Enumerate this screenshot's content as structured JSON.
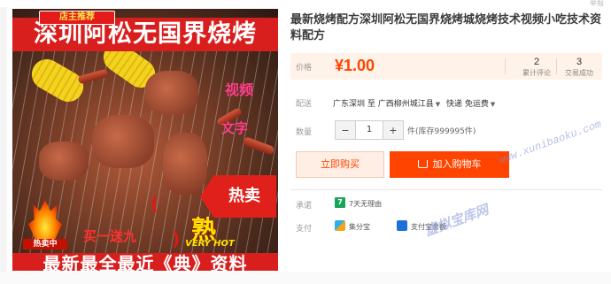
{
  "top_mark": "举报",
  "image": {
    "title": "深圳阿松无国界烧烤",
    "shop_badge": "店主推荐",
    "bottom_text": "最新最全最近《典》资料",
    "hot_arrow": "热卖",
    "hot_sticker_cn": "熟",
    "hot_sticker_en": "VERY HOT",
    "fire_badge": "热卖中",
    "pink_1": "视频",
    "pink_2": "文字",
    "red_1": "买一送九",
    "red_2": "(",
    "red_3": ")"
  },
  "product": {
    "title": "最新烧烤配方深圳阿松无国界烧烤城烧烤技术视频小吃技术资料配方"
  },
  "price": {
    "label": "价格",
    "value": "¥1.00",
    "reviews_count": "2",
    "reviews_label": "累计评论",
    "sales_count": "3",
    "sales_label": "交易成功"
  },
  "shipping": {
    "label": "配送",
    "from": "广东深圳 至",
    "to": "广西柳州城江县",
    "method": "快递 免运费"
  },
  "quantity": {
    "label": "数量",
    "minus": "−",
    "value": "1",
    "plus": "+",
    "stock": "件(库存999995件)"
  },
  "actions": {
    "buy_now": "立即购买",
    "add_to_cart": "加入购物车"
  },
  "promise": {
    "label": "承诺",
    "text": "7天无理由"
  },
  "payment": {
    "label": "支付",
    "method1": "集分宝",
    "method2": "支付宝余额"
  },
  "watermark": {
    "url": "www.xunibaoku.com",
    "cn": "虚拟宝库网"
  },
  "colors": {
    "accent": "#ff4400",
    "price_bg": "#fff2e8",
    "image_red": "#d91e1e"
  }
}
